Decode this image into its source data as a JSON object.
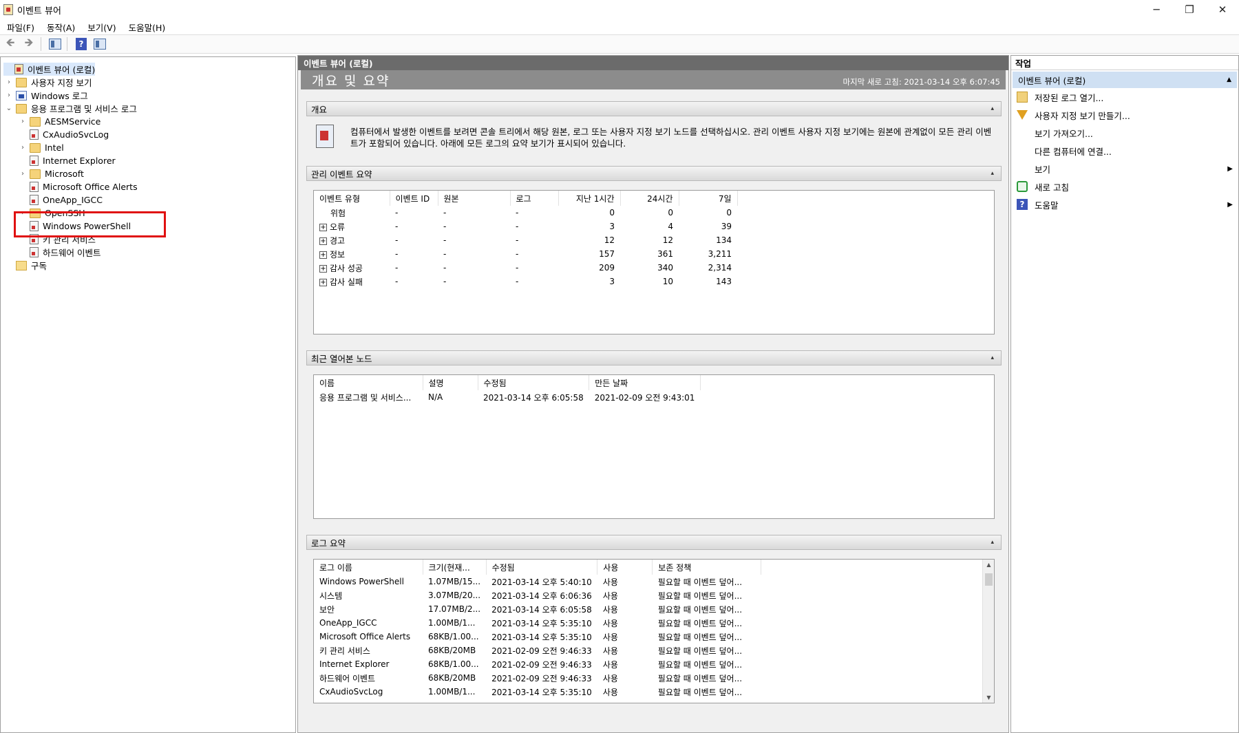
{
  "window": {
    "title": "이벤트 뷰어",
    "controls": {
      "minimize": "─",
      "restore": "❐",
      "close": "✕"
    }
  },
  "menu": [
    "파일(F)",
    "동작(A)",
    "보기(V)",
    "도움말(H)"
  ],
  "toolbar": {
    "icons": [
      "back-arrow-icon",
      "forward-arrow-icon",
      "show-hide-tree-icon",
      "help-icon",
      "show-hide-action-icon"
    ],
    "back": "🡸",
    "forward": "🡺",
    "help": "?"
  },
  "tree": {
    "root": "이벤트 뷰어 (로컬)",
    "custom_views": "사용자 지정 보기",
    "windows_logs": "Windows 로그",
    "app_logs": "응용 프로그램 및 서비스 로그",
    "app_children": [
      "AESMService",
      "CxAudioSvcLog",
      "Intel",
      "Internet Explorer",
      "Microsoft",
      "Microsoft Office Alerts",
      "OneApp_IGCC",
      "OpenSSH",
      "Windows PowerShell",
      "키 관리 서비스",
      "하드웨어 이벤트"
    ],
    "subscriptions": "구독",
    "expand_glyph": "›",
    "collapse_glyph": "⌄"
  },
  "center": {
    "header": "이벤트 뷰어 (로컬)",
    "summary_title": "개요 및 요약",
    "last_refresh": "마지막 새로 고침: 2021-03-14 오후 6:07:45",
    "overview_title": "개요",
    "overview_text": "컴퓨터에서 발생한 이벤트를 보려면 콘솔 트리에서 해당 원본, 로그 또는 사용자 지정 보기 노드를 선택하십시오. 관리 이벤트 사용자 지정 보기에는 원본에 관계없이 모든 관리 이벤트가 포함되어 있습니다. 아래에 모든 로그의 요약 보기가 표시되어 있습니다.",
    "admin_title": "관리 이벤트 요약",
    "admin_columns": [
      "이벤트 유형",
      "이벤트 ID",
      "원본",
      "로그",
      "지난 1시간",
      "24시간",
      "7일"
    ],
    "admin_rows": [
      [
        "위험",
        "-",
        "-",
        "-",
        "0",
        "0",
        "0"
      ],
      [
        "오류",
        "-",
        "-",
        "-",
        "3",
        "4",
        "39"
      ],
      [
        "경고",
        "-",
        "-",
        "-",
        "12",
        "12",
        "134"
      ],
      [
        "정보",
        "-",
        "-",
        "-",
        "157",
        "361",
        "3,211"
      ],
      [
        "감사 성공",
        "-",
        "-",
        "-",
        "209",
        "340",
        "2,314"
      ],
      [
        "감사 실패",
        "-",
        "-",
        "-",
        "3",
        "10",
        "143"
      ]
    ],
    "plus_glyph": "+",
    "recent_title": "최근 열어본 노드",
    "recent_columns": [
      "이름",
      "설명",
      "수정됨",
      "만든 날짜"
    ],
    "recent_rows": [
      [
        "응용 프로그램 및 서비스...",
        "N/A",
        "2021-03-14 오후 6:05:58",
        "2021-02-09 오전 9:43:01"
      ]
    ],
    "log_title": "로그 요약",
    "log_columns": [
      "로그 이름",
      "크기(현재...",
      "수정됨",
      "사용",
      "보존 정책"
    ],
    "log_rows": [
      [
        "Windows PowerShell",
        "1.07MB/15...",
        "2021-03-14 오후 5:40:10",
        "사용",
        "필요할 때 이벤트 덮어..."
      ],
      [
        "시스템",
        "3.07MB/20...",
        "2021-03-14 오후 6:06:36",
        "사용",
        "필요할 때 이벤트 덮어..."
      ],
      [
        "보안",
        "17.07MB/2...",
        "2021-03-14 오후 6:05:58",
        "사용",
        "필요할 때 이벤트 덮어..."
      ],
      [
        "OneApp_IGCC",
        "1.00MB/1...",
        "2021-03-14 오후 5:35:10",
        "사용",
        "필요할 때 이벤트 덮어..."
      ],
      [
        "Microsoft Office Alerts",
        "68KB/1.00...",
        "2021-03-14 오후 5:35:10",
        "사용",
        "필요할 때 이벤트 덮어..."
      ],
      [
        "키 관리 서비스",
        "68KB/20MB",
        "2021-02-09 오전 9:46:33",
        "사용",
        "필요할 때 이벤트 덮어..."
      ],
      [
        "Internet Explorer",
        "68KB/1.00...",
        "2021-02-09 오전 9:46:33",
        "사용",
        "필요할 때 이벤트 덮어..."
      ],
      [
        "하드웨어 이벤트",
        "68KB/20MB",
        "2021-02-09 오전 9:46:33",
        "사용",
        "필요할 때 이벤트 덮어..."
      ],
      [
        "CxAudioSvcLog",
        "1.00MB/1...",
        "2021-03-14 오후 5:35:10",
        "사용",
        "필요할 때 이벤트 덮어..."
      ]
    ],
    "collapse_glyph": "▴",
    "scroll_up": "▲",
    "scroll_down": "▼"
  },
  "actions": {
    "header": "작업",
    "section": "이벤트 뷰어 (로컬)",
    "items": [
      "저장된 로그 열기...",
      "사용자 지정 보기 만들기...",
      "보기 가져오기...",
      "다른 컴퓨터에 연결...",
      "보기",
      "새로 고침",
      "도움말"
    ],
    "submenu_glyph": "▶",
    "collapse_glyph": "▲",
    "help_glyph": "?"
  }
}
